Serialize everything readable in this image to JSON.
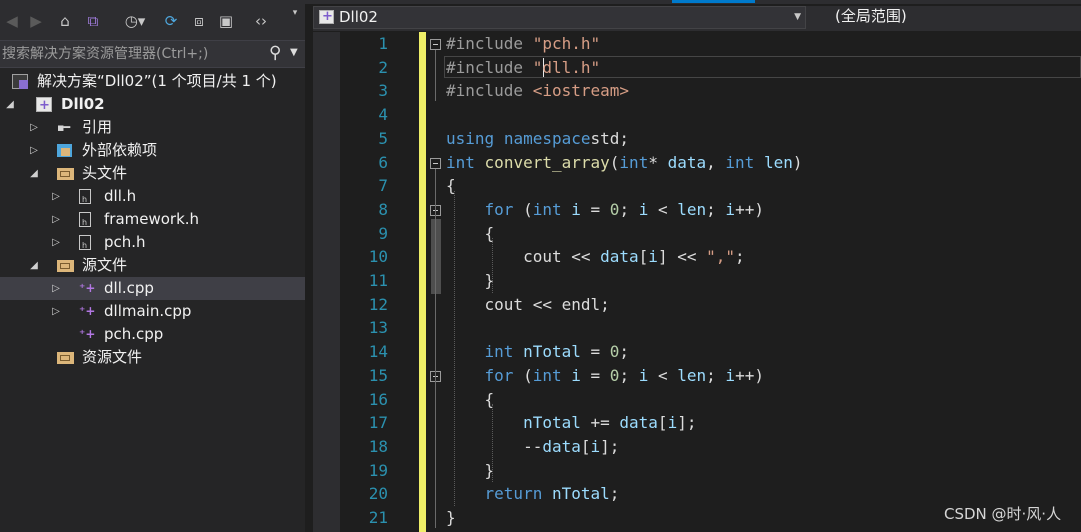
{
  "solution_explorer": {
    "search_placeholder": "搜索解决方案资源管理器(Ctrl+;)",
    "toolbar_icons": [
      "back-icon",
      "forward-icon",
      "home-icon",
      "vs-switch-icon",
      "history-icon",
      "sync-icon",
      "collapse-all-icon",
      "show-all-files-icon",
      "code-view-icon"
    ],
    "tree": [
      {
        "label": "解决方案“Dll02”(1 个项目/共 1 个)",
        "icon": "solution-icon",
        "expander": ""
      },
      {
        "label": "Dll02",
        "icon": "project-icon",
        "expander": "▲"
      },
      {
        "label": "引用",
        "icon": "references-icon",
        "expander": "▷"
      },
      {
        "label": "外部依赖项",
        "icon": "external-deps-icon",
        "expander": "▷"
      },
      {
        "label": "头文件",
        "icon": "folder-icon",
        "expander": "▲"
      },
      {
        "label": "dll.h",
        "icon": "header-file-icon",
        "expander": "▷"
      },
      {
        "label": "framework.h",
        "icon": "header-file-icon",
        "expander": "▷"
      },
      {
        "label": "pch.h",
        "icon": "header-file-icon",
        "expander": "▷"
      },
      {
        "label": "源文件",
        "icon": "folder-icon",
        "expander": "▲"
      },
      {
        "label": "dll.cpp",
        "icon": "cpp-file-icon",
        "expander": "▷",
        "selected": true
      },
      {
        "label": "dllmain.cpp",
        "icon": "cpp-file-icon",
        "expander": "▷"
      },
      {
        "label": "pch.cpp",
        "icon": "cpp-file-icon",
        "expander": ""
      },
      {
        "label": "资源文件",
        "icon": "folder-icon",
        "expander": ""
      }
    ]
  },
  "editor": {
    "file_combo": "Dll02",
    "scope_combo": "(全局范围)",
    "line_numbers": [
      "1",
      "2",
      "3",
      "4",
      "5",
      "6",
      "7",
      "8",
      "9",
      "10",
      "11",
      "12",
      "13",
      "14",
      "15",
      "16",
      "17",
      "18",
      "19",
      "20",
      "21"
    ],
    "lines": [
      [
        [
          "pp",
          "#include "
        ],
        [
          "str",
          "\"pch.h\""
        ]
      ],
      [
        [
          "pp",
          "#include "
        ],
        [
          "str",
          "\"dll.h\""
        ]
      ],
      [
        [
          "pp",
          "#include "
        ],
        [
          "str",
          "<iostream>"
        ]
      ],
      [],
      [
        [
          "kw",
          "using"
        ],
        [
          "",
          "",
          " "
        ],
        [
          "kw",
          "namespace"
        ],
        [
          "",
          "std;"
        ]
      ],
      [
        [
          "kw",
          "int"
        ],
        [
          "",
          " "
        ],
        [
          "fn",
          "convert_array"
        ],
        [
          "",
          "("
        ],
        [
          "kw",
          "int"
        ],
        [
          "",
          "* "
        ],
        [
          "var",
          "data"
        ],
        [
          "",
          ", "
        ],
        [
          "kw",
          "int"
        ],
        [
          "",
          " "
        ],
        [
          "var",
          "len"
        ],
        [
          "",
          ")"
        ]
      ],
      [
        [
          "",
          "{"
        ]
      ],
      [
        [
          "",
          "    "
        ],
        [
          "kw",
          "for"
        ],
        [
          "",
          " ("
        ],
        [
          "kw",
          "int"
        ],
        [
          "",
          " "
        ],
        [
          "var",
          "i"
        ],
        [
          "",
          " = "
        ],
        [
          "num",
          "0"
        ],
        [
          "",
          "; "
        ],
        [
          "var",
          "i"
        ],
        [
          "",
          " < "
        ],
        [
          "var",
          "len"
        ],
        [
          "",
          "; "
        ],
        [
          "var",
          "i"
        ],
        [
          "",
          "++)"
        ]
      ],
      [
        [
          "",
          "    {"
        ]
      ],
      [
        [
          "",
          "        cout << "
        ],
        [
          "var",
          "data"
        ],
        [
          "",
          "["
        ],
        [
          "var",
          "i"
        ],
        [
          "",
          "] << "
        ],
        [
          "str",
          "\",\""
        ],
        [
          "",
          ";"
        ]
      ],
      [
        [
          "",
          "    }"
        ]
      ],
      [
        [
          "",
          "    cout << endl;"
        ]
      ],
      [],
      [
        [
          "",
          "    "
        ],
        [
          "kw",
          "int"
        ],
        [
          "",
          " "
        ],
        [
          "var",
          "nTotal"
        ],
        [
          "",
          " = "
        ],
        [
          "num",
          "0"
        ],
        [
          "",
          ";"
        ]
      ],
      [
        [
          "",
          "    "
        ],
        [
          "kw",
          "for"
        ],
        [
          "",
          " ("
        ],
        [
          "kw",
          "int"
        ],
        [
          "",
          " "
        ],
        [
          "var",
          "i"
        ],
        [
          "",
          " = "
        ],
        [
          "num",
          "0"
        ],
        [
          "",
          "; "
        ],
        [
          "var",
          "i"
        ],
        [
          "",
          " < "
        ],
        [
          "var",
          "len"
        ],
        [
          "",
          "; "
        ],
        [
          "var",
          "i"
        ],
        [
          "",
          "++)"
        ]
      ],
      [
        [
          "",
          "    {"
        ]
      ],
      [
        [
          "",
          "        "
        ],
        [
          "var",
          "nTotal"
        ],
        [
          "",
          " += "
        ],
        [
          "var",
          "data"
        ],
        [
          "",
          "["
        ],
        [
          "var",
          "i"
        ],
        [
          "",
          "];"
        ]
      ],
      [
        [
          "",
          "        --"
        ],
        [
          "var",
          "data"
        ],
        [
          "",
          "["
        ],
        [
          "var",
          "i"
        ],
        [
          "",
          "];"
        ]
      ],
      [
        [
          "",
          "    }"
        ]
      ],
      [
        [
          "",
          "    "
        ],
        [
          "kw",
          "return"
        ],
        [
          "",
          " "
        ],
        [
          "var",
          "nTotal"
        ],
        [
          "",
          ";"
        ]
      ],
      [
        [
          "",
          "}"
        ]
      ]
    ]
  },
  "watermark": "CSDN @时·风·人"
}
